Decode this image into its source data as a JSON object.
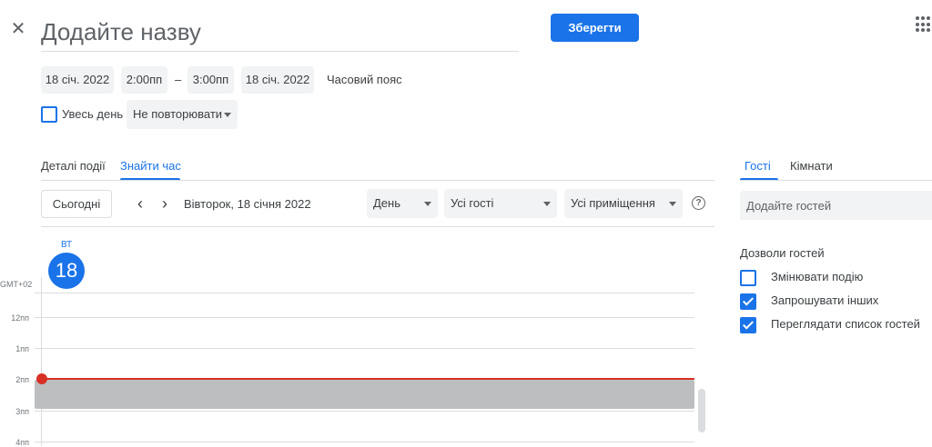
{
  "header": {
    "title_placeholder": "Додайте назву",
    "save_label": "Зберегти"
  },
  "datetime": {
    "start_date": "18 січ. 2022",
    "start_time": "2:00пп",
    "separator": "–",
    "end_time": "3:00пп",
    "end_date": "18 січ. 2022",
    "timezone_label": "Часовий пояс"
  },
  "options": {
    "all_day_label": "Увесь день",
    "all_day_checked": false,
    "repeat_value": "Не повторювати"
  },
  "tabs": [
    {
      "label": "Деталі події",
      "active": false
    },
    {
      "label": "Знайти час",
      "active": true
    }
  ],
  "toolbar": {
    "today_label": "Сьогодні",
    "date_label": "Вівторок, 18 січня 2022",
    "view_dropdown": "День",
    "guests_dropdown": "Усі гості",
    "rooms_dropdown": "Усі приміщення",
    "help_glyph": "?"
  },
  "calendar": {
    "day_abbr": "ВТ",
    "day_number": "18",
    "timezone": "GMT+02",
    "hours": [
      "12пп",
      "1пп",
      "2пп",
      "3пп",
      "4пп"
    ],
    "event_start": "2:00пп",
    "event_end": "3:00пп"
  },
  "side_tabs": [
    {
      "label": "Гості",
      "active": true
    },
    {
      "label": "Кімнати",
      "active": false
    }
  ],
  "guests": {
    "add_placeholder": "Додайте гостей",
    "permissions_title": "Дозволи гостей",
    "permissions": [
      {
        "label": "Змінювати подію",
        "checked": false
      },
      {
        "label": "Запрошувати інших",
        "checked": true
      },
      {
        "label": "Переглядати список гостей",
        "checked": true
      }
    ]
  },
  "colors": {
    "accent": "#1a73e8",
    "now_indicator": "#d93025",
    "event_block": "#bdbec0"
  }
}
